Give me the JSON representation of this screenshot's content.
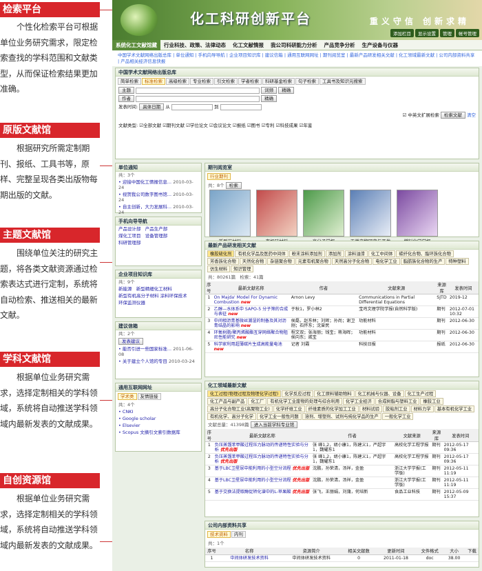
{
  "left": {
    "sections": [
      {
        "title": "检索平台",
        "text": "个性化检索平台可根据单位业务研究需求，限定检索查找的学科范围和文献类型，从而保证检索结果更加准确。"
      },
      {
        "title": "原版文献馆",
        "text": "根据研究所需定制期刊、报纸、工具书等，原样、完整呈现各类出版物每期出版的文献。"
      },
      {
        "title": "主题文献馆",
        "text": "围绕单位关注的研究主题，将各类文献资源通过检索表达式进行定制，系统将自动检索、推送相关的最新文献。"
      },
      {
        "title": "学科文献馆",
        "text": "根据单位业务研究需求，选择定制相关的学科领域，系统将自动推送学科领域内最新发表的文献成果。"
      },
      {
        "title": "自创资源馆",
        "text": "根据单位业务研究需求，选择定制相关的学科领域，系统将自动推送学科领域内最新发表的文献成果。"
      }
    ]
  },
  "app": {
    "title": "化工科研创新平台",
    "slogan": "重义守信 创新求精",
    "toplinks": [
      "添加栏目",
      "显示设置",
      "管理",
      "帐号管理"
    ],
    "nav": [
      "系统化工文献馆藏",
      "行业科技、政策、法律动态",
      "化工文献情报",
      "我公司科研能力分析",
      "产品竞争分析",
      "生产设备与仪器"
    ],
    "sublinks": "中国学术文献网络出版总库 | 单位通知 | 手机向导导航 | 企业项目知识库 | 建议信箱 | 通用互联网网址 | 期刊阅览室 | 最新产品研发相关文献 | 化工领域最新文献 | 公司内部资料共享 | 产品相关经济信息快报",
    "search": {
      "header": "中国学术文献网络出版总库",
      "tabs": [
        "简单检索",
        "标准检索",
        "高级检索",
        "专业检索",
        "引文检索",
        "学者检索",
        "科研基金检索",
        "句子检索",
        "工具书及知识元搜索"
      ],
      "field1": "主题",
      "field2": "作者",
      "mode1": "词频",
      "mode2": "精确",
      "mode3": "精确",
      "datelabel": "发表时间:",
      "dateopt": "具体日期",
      "from": "从",
      "to": "到",
      "chinese": "中英文扩展检索",
      "btn": "检索文献",
      "clear": "清空",
      "typelabel": "文献类型:",
      "types": [
        "全部文献",
        "期刊文献",
        "学位论文",
        "会议论文",
        "报纸",
        "图书",
        "专利",
        "科技成果",
        "年鉴"
      ]
    },
    "notice": {
      "header": "单位通知",
      "count": "共：3个",
      "items": [
        [
          "• 迎接中国化工情报信息...",
          "2010-03-24"
        ],
        [
          "• 视贺我公司数字图书馆...",
          "2010-03-24"
        ],
        [
          "• 自主创新，大力发展科...",
          "2010-03-24"
        ]
      ]
    },
    "phone": {
      "header": "手机向导导航",
      "items": [
        "产品设计部",
        "产品生产部",
        "煤化工项目",
        "设备管理部",
        "科研管理部"
      ]
    },
    "proj": {
      "header": "企业项目知识库",
      "count": "共：9个",
      "items": [
        "新能源",
        "新型精细化工材料",
        "新型有机高分子材料",
        "涂料环保技术",
        "环保监测仪器"
      ]
    },
    "suggest": {
      "header": "建议信箱",
      "count": "共：2个",
      "btn": "发表建议",
      "items": [
        [
          "• 能否引进一些国家标准...",
          "2011-06-08"
        ],
        [
          "• 关于建立个人馆的专目",
          "2010-03-24"
        ]
      ]
    },
    "web": {
      "header": "通用互联网网址",
      "tabs": [
        "学术类",
        "友情链接"
      ],
      "count": "共：4个",
      "items": [
        "• CNKI",
        "• Google scholar",
        "• Elsevier",
        "• Scopus 文摘引文索引数据库"
      ]
    },
    "journal": {
      "header": "期刊阅览室",
      "tab": "行业期刊",
      "count": "共：8个",
      "btn": "检索",
      "titles": [
        "新型炭材料",
        "有机硅材料",
        "高分子学报",
        "天然产物研究与开发",
        "燃料化学学报"
      ]
    },
    "prod": {
      "header": "最新产品研发相关文献",
      "chips": [
        "橡胶硫化剂",
        "有机化学品及医药中间体",
        "粉末涂料添加剂",
        "添加剂",
        "涂料油漆",
        "化工中间体",
        "碳纤化合物、脂环族化合物",
        "芳香族化合物",
        "天然化合物",
        "杂链聚合物",
        "元素有机聚合物",
        "天然高分子化合物",
        "电化学工业",
        "脂肪族化合物的生产",
        "特种塑料",
        "仿生材料",
        "知识管理"
      ],
      "count": "共：80261篇",
      "count2": "检索：41篇",
      "cols": [
        "序号",
        "最新文献名称",
        "作者",
        "文献来源",
        "来源库",
        "发表时间"
      ],
      "rows": [
        [
          "1",
          "On Majda' Model For Dynamic Combustion",
          "Arnon Levy",
          "Communications in Partial Differential Equations",
          "SJTD",
          "2019-12"
        ],
        [
          "2",
          "乙醇—水体系中 SAPO-5 分子筛的合成与表征",
          "于秋1，罗小林2",
          "宝鸡文理学院学报(自然科学版)",
          "期刊",
          "2012-07-01 10:32"
        ],
        [
          "3",
          "中间相沥青基微丝潮湿的制备及其对沥青结晶的影响",
          "侯磊，赵东林；刘辉；孙尚；谢卫刚；石怀东；沈曾民",
          "功能材料",
          "期刊",
          "2012-06-30"
        ],
        [
          "4",
          "环氧树脂/聚丙烯酸酯互穿网络聚合物阻尼性能研究",
          "程文双；张海丽；钱宝；蒋海晖；侯向东；戚宝",
          "功能材料",
          "期刊",
          "2012-06-30"
        ],
        [
          "5",
          "科学家利用超薄碳片生成高能量电池",
          "记者 刘霞",
          "科技日报",
          "报纸",
          "2012-06-30"
        ]
      ]
    },
    "field": {
      "header": "化工领域最新文献",
      "chips": [
        "化工过程(物理过程及物理化学过程)",
        "化学反应过程",
        "化工原料辅助物料",
        "化工机械与仪器、设备",
        "化工生产过程",
        "化工产品与副产品",
        "化工厂",
        "有机化学工业废物的处理与综合利用",
        "化学工业经济",
        "合成树脂与塑料工业",
        "橡胶工业",
        "高分子化合物工业(高聚物工业)",
        "化学纤维工业",
        "纤维素质的化学加工工业",
        "材料试验",
        "胶粘剂工业",
        "材料力学",
        "基本有机化学工业",
        "有机化学、高分子化学",
        "化学工业一般性问题",
        "溶剂、增塑剂、试剂与纯化学品的生产",
        "一般化学工业"
      ],
      "count": "文献总量：41398篇",
      "btn": "进入当前学科专业馆",
      "cols": [
        "序号",
        "最新文献名称",
        "作者",
        "文献来源",
        "来源库",
        "发表时间"
      ],
      "rows": [
        [
          "1",
          "负压蒸馏苯甲酸过程压力脉动的传递特性实验与分析",
          "张 峰1,2，胡小康1，陈建义1，严超宇1，魏耀东1",
          "高校化学工程学报",
          "期刊",
          "2012-05-17 09:36"
        ],
        [
          "2",
          "负压蒸馏苯甲酸过程压力脉动的传递特性实验与分析",
          "张 峰1,2，胡小康1，陈建义1，严超宇1，魏耀东1",
          "高校化学工程学报",
          "期刊",
          "2012-05-17 09:36"
        ],
        [
          "3",
          "基于LBC卫星尿中能利用的小型空分流程",
          "沈鹏，孙荣清，汤祥，金盈",
          "浙江大学学报(工学版)",
          "期刊",
          "2012-05-11 11:19"
        ],
        [
          "4",
          "基于LBC卫星尿中能利用的小型空分流程",
          "沈鹏，孙荣清，汤祥，金盈",
          "浙江大学学报(工学版)",
          "期刊",
          "2012-05-11 11:19"
        ],
        [
          "5",
          "基于交换法提取酶促转化谱中的L-苹果酸",
          "张飞，王丽娟，刘蒲，何培新",
          "食品工业科技",
          "期刊",
          "2012-05-09 15:37"
        ]
      ]
    },
    "share": {
      "header": "公司内部资料共享",
      "tabs": [
        "技术资料",
        "内刊"
      ],
      "count": "共：1个",
      "cols": [
        "序号",
        "名称",
        "资源简介",
        "相关文献数",
        "更新时间",
        "文件格式",
        "大小",
        "下载"
      ],
      "row": [
        "1",
        "中间体研发技术资料",
        "中间体研发技术资料",
        "0",
        "2011-01-18",
        "doc",
        "38.00",
        ""
      ]
    },
    "newtag": "new",
    "newtag2": "优先出版"
  }
}
